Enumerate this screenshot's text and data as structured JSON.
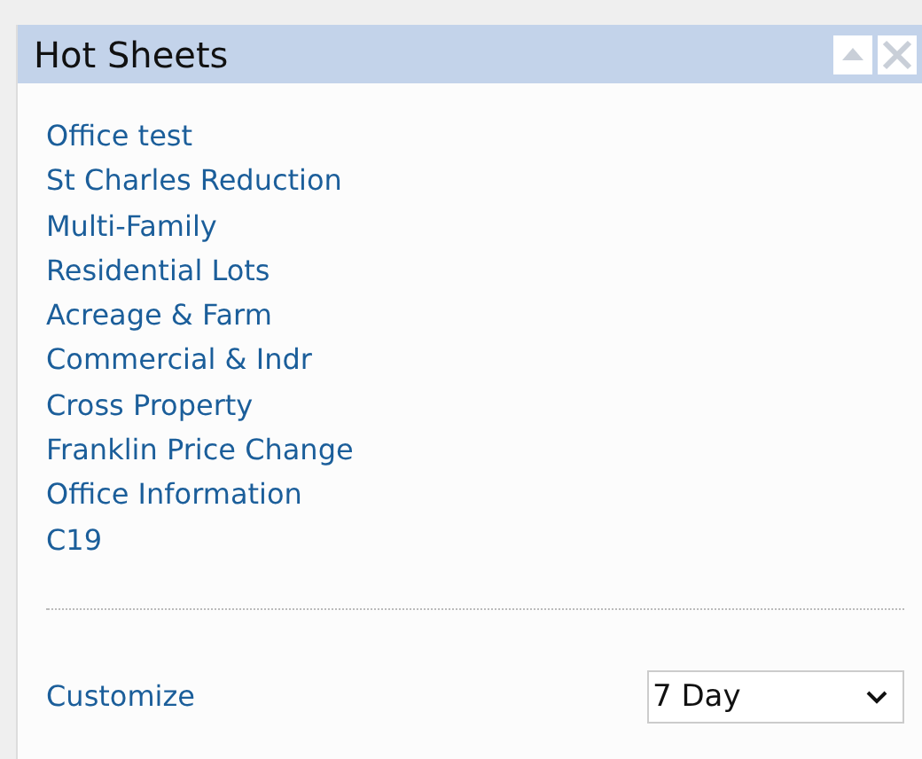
{
  "panel": {
    "title": "Hot Sheets"
  },
  "links": [
    "Office test",
    "St Charles Reduction",
    "Multi-Family",
    "Residential Lots",
    "Acreage & Farm",
    "Commercial & Indr",
    "Cross Property",
    "Franklin Price Change",
    "Office Information",
    "C19"
  ],
  "footer": {
    "link": "Customize",
    "period": "7 Day"
  }
}
